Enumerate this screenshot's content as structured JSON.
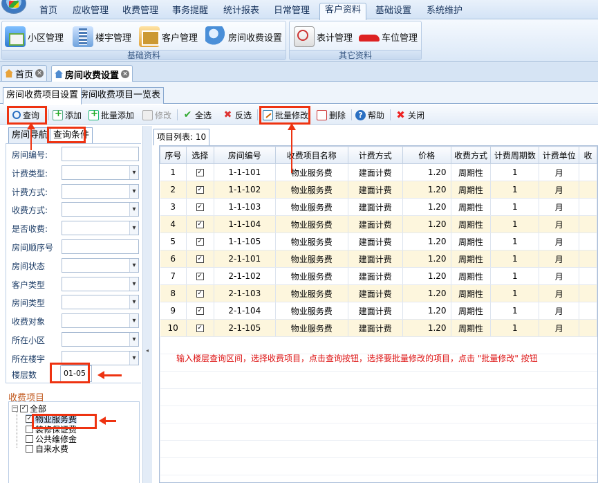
{
  "menu": {
    "items": [
      "首页",
      "应收管理",
      "收费管理",
      "事务提醒",
      "统计报表",
      "日常管理",
      "客户资料",
      "基础设置",
      "系统维护"
    ],
    "active_index": 6
  },
  "ribbon": {
    "group1_label": "基础资料",
    "group2_label": "其它资料",
    "buttons": [
      {
        "label": "小区管理",
        "icon": "community-icon"
      },
      {
        "label": "楼宇管理",
        "icon": "building-icon"
      },
      {
        "label": "客户管理",
        "icon": "customer-icon"
      },
      {
        "label": "房间收费设置",
        "icon": "room-fee-icon"
      },
      {
        "label": "表计管理",
        "icon": "meter-icon"
      },
      {
        "label": "车位管理",
        "icon": "car-icon"
      }
    ]
  },
  "doc_tabs": [
    {
      "label": "首页"
    },
    {
      "label": "房间收费设置"
    }
  ],
  "sub_tabs": [
    "房间收费项目设置",
    "房间收费项目一览表"
  ],
  "toolbar": {
    "query": "查询",
    "add": "添加",
    "batch_add": "批量添加",
    "edit": "修改",
    "select_all": "全选",
    "invert": "反选",
    "batch_edit": "批量修改",
    "delete": "删除",
    "help": "帮助",
    "close": "关闭"
  },
  "left_tabs": [
    "房间导航",
    "查询条件"
  ],
  "filters": [
    {
      "label": "房间编号:",
      "type": "text",
      "value": ""
    },
    {
      "label": "计费类型:",
      "type": "select",
      "value": ""
    },
    {
      "label": "计费方式:",
      "type": "select",
      "value": ""
    },
    {
      "label": "收费方式:",
      "type": "select",
      "value": ""
    },
    {
      "label": "是否收费:",
      "type": "select",
      "value": ""
    },
    {
      "label": "房间顺序号",
      "type": "text",
      "value": ""
    },
    {
      "label": "房间状态",
      "type": "select",
      "value": ""
    },
    {
      "label": "客户类型",
      "type": "select",
      "value": ""
    },
    {
      "label": "房间类型",
      "type": "select",
      "value": ""
    },
    {
      "label": "收费对象",
      "type": "select",
      "value": ""
    },
    {
      "label": "所在小区",
      "type": "select",
      "value": ""
    },
    {
      "label": "所在楼宇",
      "type": "select",
      "value": ""
    },
    {
      "label": "楼层数",
      "type": "text",
      "value": "01-05"
    }
  ],
  "fee_items": {
    "title": "收费项目",
    "root": "全部",
    "items": [
      {
        "label": "物业服务费",
        "checked": true
      },
      {
        "label": "装修保证费",
        "checked": false
      },
      {
        "label": "公共维修金",
        "checked": false
      },
      {
        "label": "自来水费",
        "checked": false
      }
    ]
  },
  "list_tab": "项目列表: 10",
  "grid": {
    "columns": [
      "序号",
      "选择",
      "房间编号",
      "收费项目名称",
      "计费方式",
      "价格",
      "收费方式",
      "计费周期数",
      "计费单位",
      "收"
    ],
    "rows": [
      [
        "1",
        "✓",
        "1-1-101",
        "物业服务费",
        "建面计费",
        "1.20",
        "周期性",
        "1",
        "月",
        ""
      ],
      [
        "2",
        "✓",
        "1-1-102",
        "物业服务费",
        "建面计费",
        "1.20",
        "周期性",
        "1",
        "月",
        ""
      ],
      [
        "3",
        "✓",
        "1-1-103",
        "物业服务费",
        "建面计费",
        "1.20",
        "周期性",
        "1",
        "月",
        ""
      ],
      [
        "4",
        "✓",
        "1-1-104",
        "物业服务费",
        "建面计费",
        "1.20",
        "周期性",
        "1",
        "月",
        ""
      ],
      [
        "5",
        "✓",
        "1-1-105",
        "物业服务费",
        "建面计费",
        "1.20",
        "周期性",
        "1",
        "月",
        ""
      ],
      [
        "6",
        "✓",
        "2-1-101",
        "物业服务费",
        "建面计费",
        "1.20",
        "周期性",
        "1",
        "月",
        ""
      ],
      [
        "7",
        "✓",
        "2-1-102",
        "物业服务费",
        "建面计费",
        "1.20",
        "周期性",
        "1",
        "月",
        ""
      ],
      [
        "8",
        "✓",
        "2-1-103",
        "物业服务费",
        "建面计费",
        "1.20",
        "周期性",
        "1",
        "月",
        ""
      ],
      [
        "9",
        "✓",
        "2-1-104",
        "物业服务费",
        "建面计费",
        "1.20",
        "周期性",
        "1",
        "月",
        ""
      ],
      [
        "10",
        "✓",
        "2-1-105",
        "物业服务费",
        "建面计费",
        "1.20",
        "周期性",
        "1",
        "月",
        ""
      ]
    ]
  },
  "instruction": "输入楼层查询区间，选择收费项目，点击查询按钮，选择要批量修改的项目，点击 \"批量修改\" 按钮",
  "colors": {
    "highlight": "#e31",
    "alt_row": "#fdf6dd",
    "group_title": "#c0561a"
  }
}
